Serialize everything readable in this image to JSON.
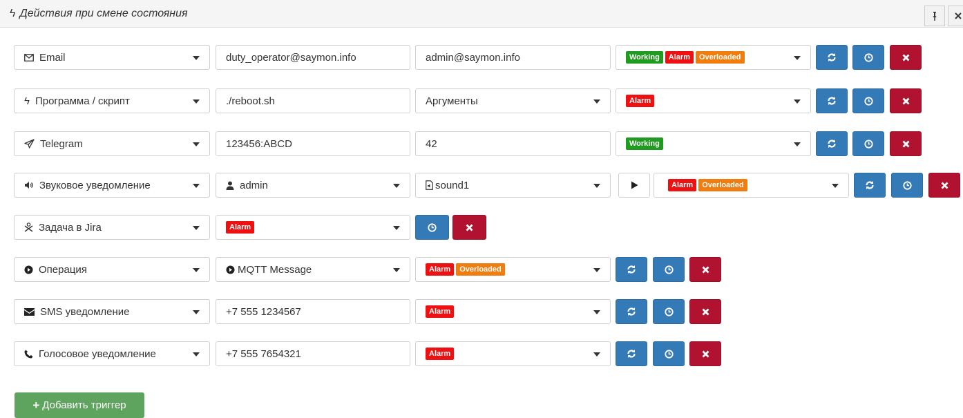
{
  "panel": {
    "title": "Действия при смене состояния"
  },
  "rows": [
    {
      "type": "Email",
      "target": "duty_operator@saymon.info",
      "arg": "admin@saymon.info",
      "states": [
        "Working",
        "Alarm",
        "Overloaded"
      ]
    },
    {
      "type": "Программа / скрипт",
      "target": "./reboot.sh",
      "arg": "Аргументы",
      "states": [
        "Alarm"
      ]
    },
    {
      "type": "Telegram",
      "target": "123456:ABCD",
      "arg": "42",
      "states": [
        "Working"
      ]
    },
    {
      "type": "Звуковое уведомление",
      "target": "admin",
      "arg": "sound1",
      "states": [
        "Alarm",
        "Overloaded"
      ]
    },
    {
      "type": "Задача в Jira",
      "states": [
        "Alarm"
      ]
    },
    {
      "type": "Операция",
      "target": "MQTT Message",
      "states": [
        "Alarm",
        "Overloaded"
      ]
    },
    {
      "type": "SMS уведомление",
      "target": "+7 555 1234567",
      "states": [
        "Alarm"
      ]
    },
    {
      "type": "Голосовое уведомление",
      "target": "+7 555 7654321",
      "states": [
        "Alarm"
      ]
    }
  ],
  "add_button": {
    "label": "Добавить триггер"
  },
  "colors": {
    "working": "#1f9b1f",
    "alarm": "#ee1111",
    "overloaded": "#f07d0f",
    "blue": "#337ab7",
    "red": "#b01230",
    "green": "#5ea45e"
  },
  "icons": [
    "bolt-icon",
    "pin-icon",
    "close-icon",
    "envelope-outline-icon",
    "paper-plane-icon",
    "volume-icon",
    "user-icon",
    "audio-file-icon",
    "jira-icon",
    "play-circle-icon",
    "envelope-icon",
    "phone-icon",
    "refresh-icon",
    "clock-icon",
    "times-icon",
    "play-icon",
    "plus-icon"
  ]
}
